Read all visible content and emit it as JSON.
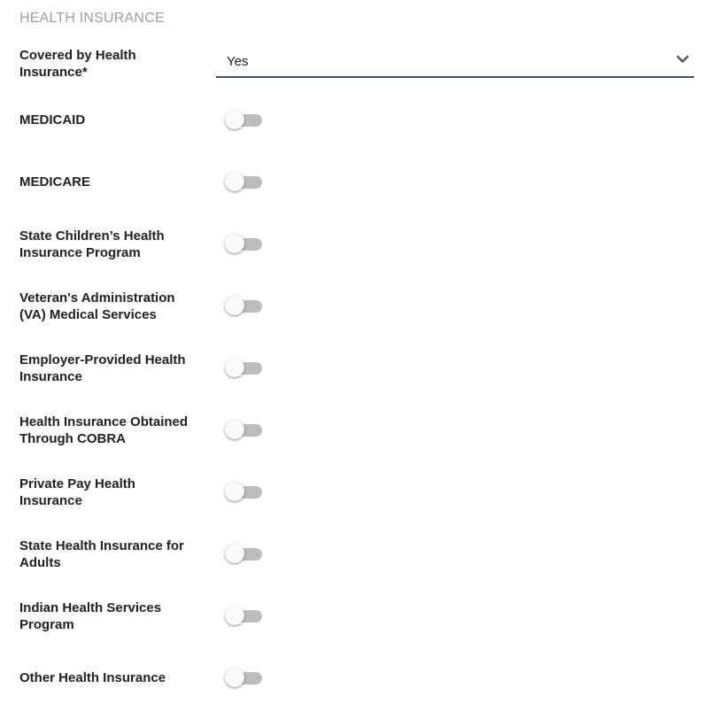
{
  "section": {
    "title": "HEALTH INSURANCE"
  },
  "covered": {
    "label": "Covered by Health Insurance*",
    "value": "Yes"
  },
  "toggles": [
    {
      "label": "MEDICAID",
      "on": false
    },
    {
      "label": "MEDICARE",
      "on": false
    },
    {
      "label": "State Children’s Health Insurance Program",
      "on": false
    },
    {
      "label": "Veteran's Administration (VA) Medical Services",
      "on": false
    },
    {
      "label": "Employer-Provided Health Insurance",
      "on": false
    },
    {
      "label": "Health Insurance Obtained Through COBRA",
      "on": false
    },
    {
      "label": "Private Pay Health Insurance",
      "on": false
    },
    {
      "label": "State Health Insurance for Adults",
      "on": false
    },
    {
      "label": "Indian Health Services Program",
      "on": false
    },
    {
      "label": "Other Health Insurance",
      "on": false
    }
  ],
  "colors": {
    "underline": "#3f4f7a",
    "track_off": "#bdbdbd",
    "section_title": "#9e9e9e"
  },
  "icons": {
    "dropdown": "chevron-down-icon"
  }
}
